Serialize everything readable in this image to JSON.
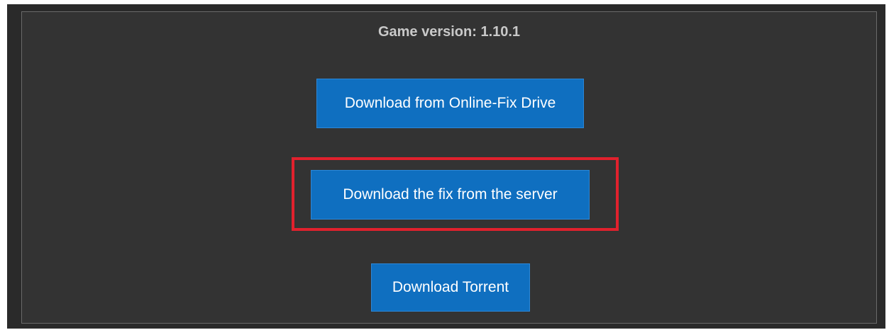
{
  "panel": {
    "game_version": "Game version: 1.10.1"
  },
  "buttons": {
    "online_fix_drive": "Download from Online-Fix Drive",
    "server_fix": "Download the fix from the server",
    "torrent": "Download Torrent"
  },
  "colors": {
    "panel_background": "#333333",
    "button_background": "#0f6fc0",
    "highlight_border": "#e1212d",
    "version_text": "#c9c9c9"
  }
}
